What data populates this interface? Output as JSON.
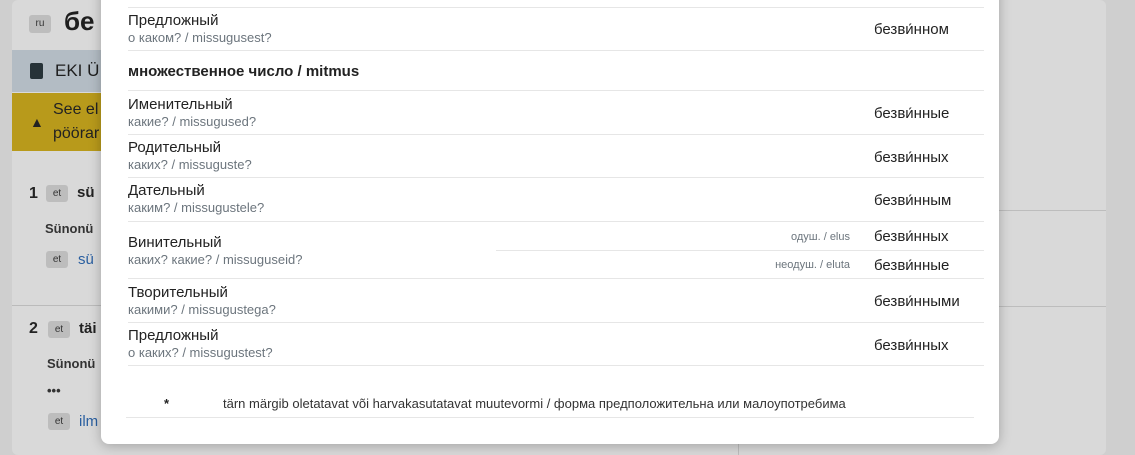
{
  "background": {
    "lang_badge": "ru",
    "word": "бе",
    "eki_label": "EKI Ü",
    "warning_line1": "See el",
    "warning_line2": "pöörar",
    "senses": [
      {
        "num": "1",
        "lang": "et",
        "text": "sü",
        "synonym_label": "Sünonü",
        "syn_lang": "et",
        "syn_link": "sü"
      },
      {
        "num": "2",
        "lang": "et",
        "text": "täi",
        "synonym_label": "Sünonü",
        "more": "•••",
        "syn_lang": "et",
        "syn_link": "ilm"
      }
    ]
  },
  "modal": {
    "top_case": {
      "name": "Предложный",
      "question": "о каком? / missugusest?",
      "form": "безви́нном"
    },
    "plural_heading": "множественное число / mitmus",
    "plural_cases": [
      {
        "name": "Именительный",
        "question": "какие? / missugused?",
        "form": "безви́нные"
      },
      {
        "name": "Родительный",
        "question": "каких? / missuguste?",
        "form": "безви́нных"
      },
      {
        "name": "Дательный",
        "question": "каким? / missugustele?",
        "form": "безви́нным"
      },
      {
        "name": "Винительный",
        "question": "каких? какие? / missuguseid?",
        "sub": [
          {
            "animacy": "одуш. / elus",
            "form": "безви́нных"
          },
          {
            "animacy": "неодуш. / eluta",
            "form": "безви́нные"
          }
        ]
      },
      {
        "name": "Творительный",
        "question": "какими? / missugustega?",
        "form": "безви́нными"
      },
      {
        "name": "Предложный",
        "question": "о каких? / missugustest?",
        "form": "безви́нных"
      }
    ],
    "footnote": {
      "star": "*",
      "text": "tärn märgib oletatavat või harvakasutatavat muutevormi / форма предположительна или малоупотребима"
    }
  }
}
